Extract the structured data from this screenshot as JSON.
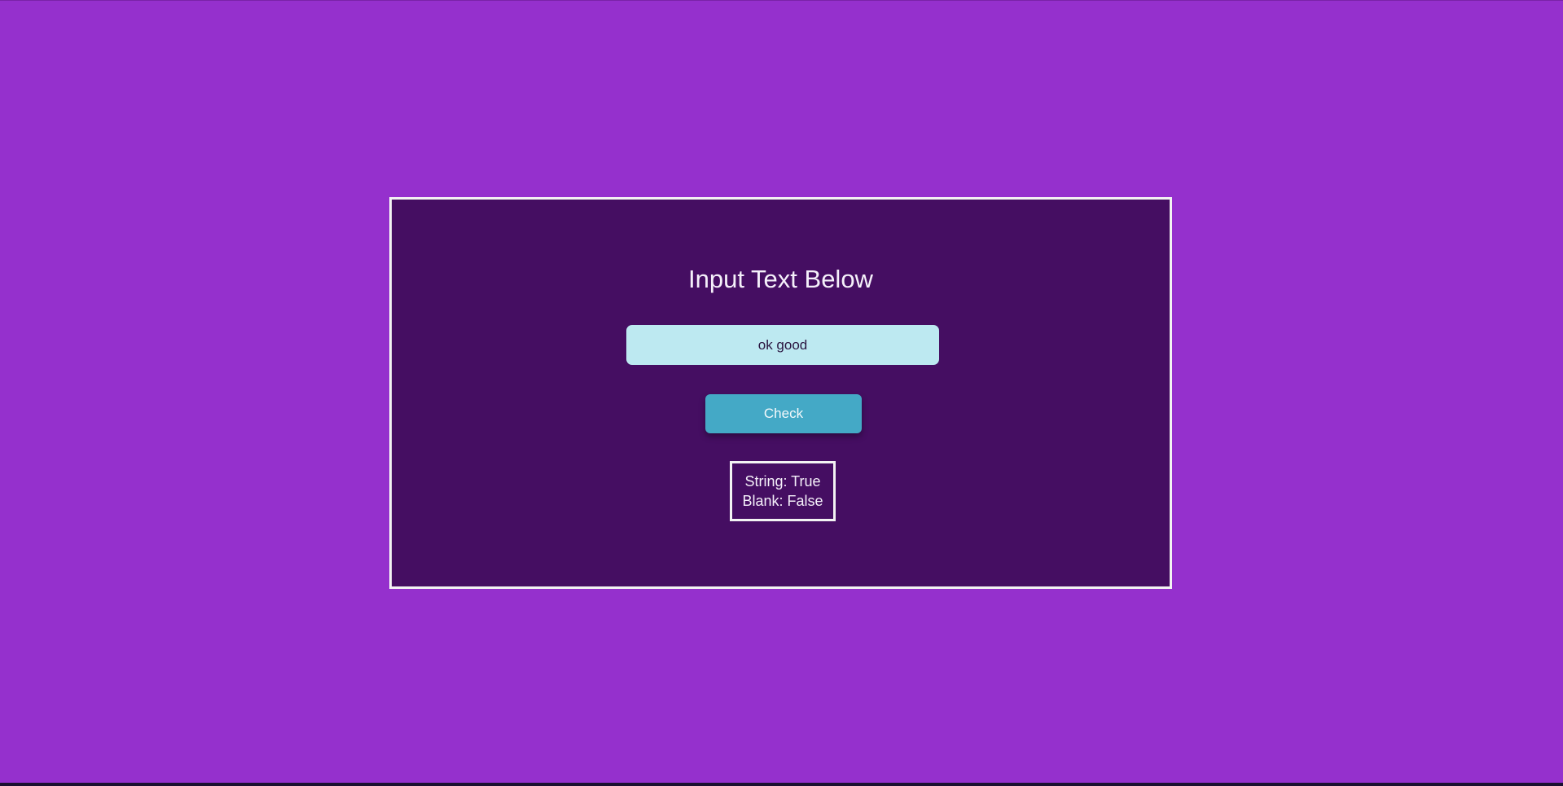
{
  "page": {
    "background_color": "#9530cd",
    "card_color": "#450e62",
    "accent_color": "#44a9c6",
    "input_color": "#bde9f1"
  },
  "card": {
    "title": "Input Text Below",
    "input": {
      "value": "ok good",
      "placeholder": ""
    },
    "check_button": {
      "label": "Check"
    },
    "result": {
      "string_line": "String: True",
      "blank_line": "Blank: False"
    }
  }
}
